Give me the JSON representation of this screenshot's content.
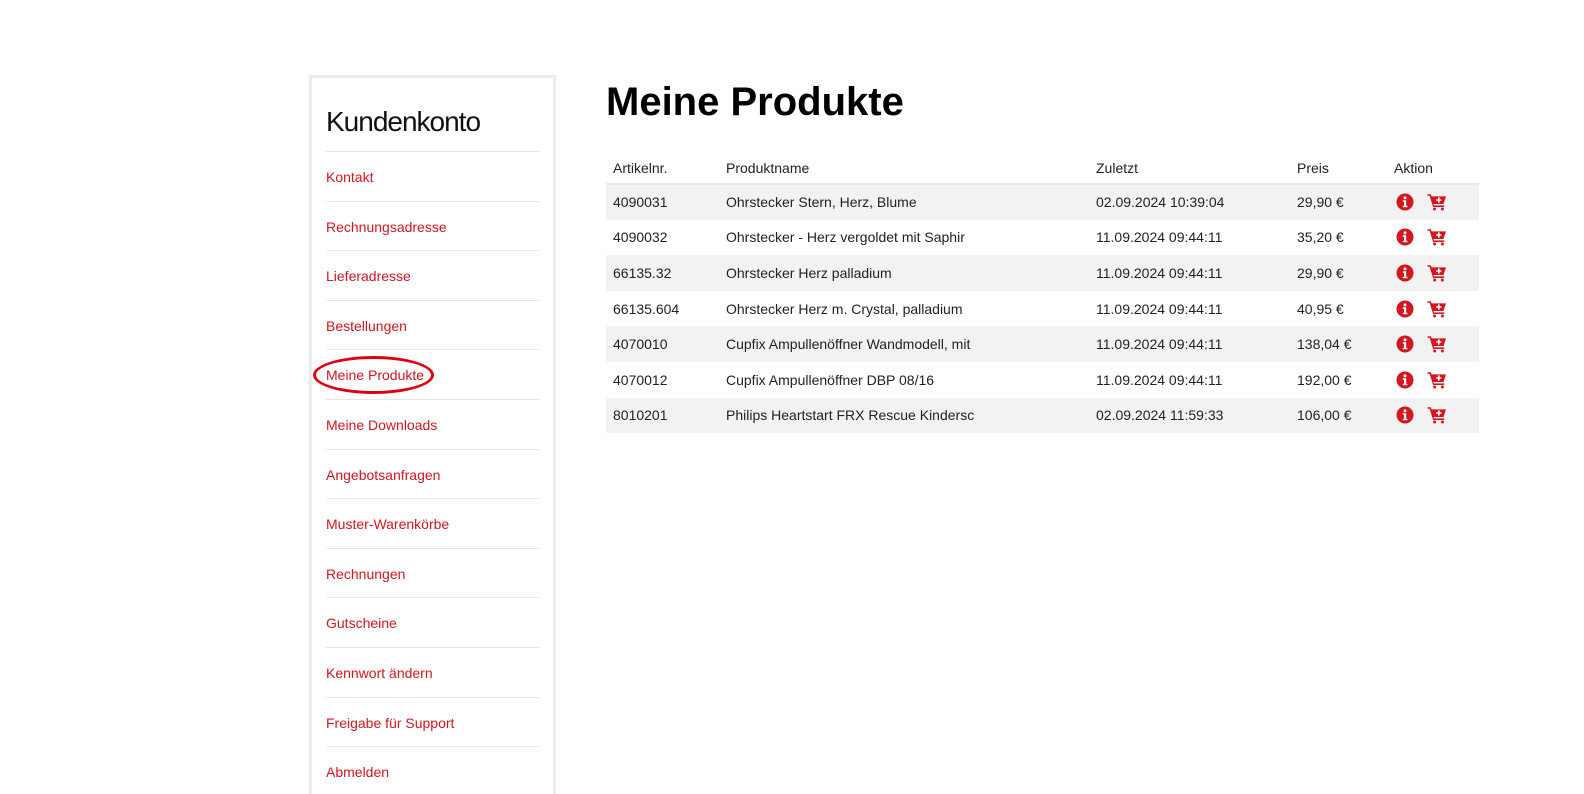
{
  "sidebar": {
    "title": "Kundenkonto",
    "items": [
      {
        "label": "Kontakt"
      },
      {
        "label": "Rechnungsadresse"
      },
      {
        "label": "Lieferadresse"
      },
      {
        "label": "Bestellungen"
      },
      {
        "label": "Meine Produkte",
        "active": true
      },
      {
        "label": "Meine Downloads"
      },
      {
        "label": "Angebotsanfragen"
      },
      {
        "label": "Muster-Warenkörbe"
      },
      {
        "label": "Rechnungen"
      },
      {
        "label": "Gutscheine"
      },
      {
        "label": "Kennwort ändern"
      },
      {
        "label": "Freigabe für Support"
      },
      {
        "label": "Abmelden"
      }
    ]
  },
  "main": {
    "title": "Meine Produkte",
    "table": {
      "headers": {
        "article": "Artikelnr.",
        "name": "Produktname",
        "last": "Zuletzt",
        "price": "Preis",
        "action": "Aktion"
      },
      "rows": [
        {
          "article": "4090031",
          "name": "Ohrstecker Stern, Herz, Blume",
          "last": "02.09.2024 10:39:04",
          "price": "29,90 €"
        },
        {
          "article": "4090032",
          "name": "Ohrstecker - Herz vergoldet mit Saphir",
          "last": "11.09.2024 09:44:11",
          "price": "35,20 €"
        },
        {
          "article": "66135.32",
          "name": "Ohrstecker Herz palladium",
          "last": "11.09.2024 09:44:11",
          "price": "29,90 €"
        },
        {
          "article": "66135.604",
          "name": "Ohrstecker Herz m. Crystal, palladium",
          "last": "11.09.2024 09:44:11",
          "price": "40,95 €"
        },
        {
          "article": "4070010",
          "name": "Cupfix Ampullenöffner Wandmodell, mit",
          "last": "11.09.2024 09:44:11",
          "price": "138,04 €"
        },
        {
          "article": "4070012",
          "name": "Cupfix Ampullenöffner DBP 08/16",
          "last": "11.09.2024 09:44:11",
          "price": "192,00 €"
        },
        {
          "article": "8010201",
          "name": "Philips Heartstart FRX Rescue Kindersc",
          "last": "02.09.2024 11:59:33",
          "price": "106,00 €"
        }
      ],
      "row_actions": [
        "info-icon",
        "add-to-cart-icon"
      ]
    }
  },
  "colors": {
    "accent": "#d3161f",
    "highlight_ring": "#e00010",
    "row_stripe": "#f2f2f2"
  }
}
